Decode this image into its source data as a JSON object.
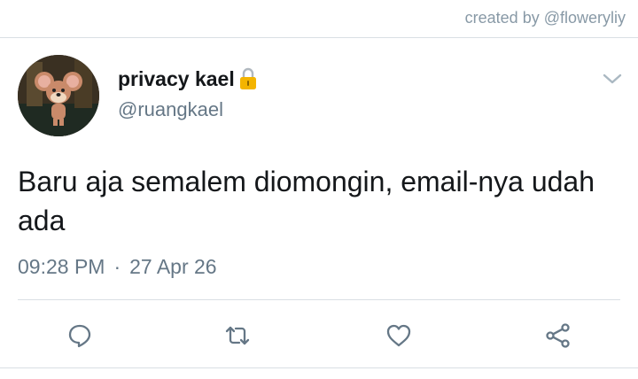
{
  "credit": {
    "text": "created by @floweryliy"
  },
  "tweet": {
    "author": {
      "display_name": "privacy kael",
      "handle": "@ruangkael",
      "avatar_icon": "cartoon-mouse-avatar",
      "badge_icon": "lock-icon"
    },
    "text": "Baru aja semalem diomongin, email-nya udah ada",
    "time": "09:28 PM",
    "separator": "·",
    "date": "27 Apr 26"
  },
  "actions": [
    {
      "name": "reply",
      "icon": "reply-icon"
    },
    {
      "name": "retweet",
      "icon": "retweet-icon"
    },
    {
      "name": "like",
      "icon": "heart-icon"
    },
    {
      "name": "share",
      "icon": "share-icon"
    }
  ],
  "colors": {
    "text_primary": "#14171a",
    "text_secondary": "#657786",
    "icon": "#657786",
    "divider": "#d9dfe4",
    "lock": "#f4b400"
  }
}
